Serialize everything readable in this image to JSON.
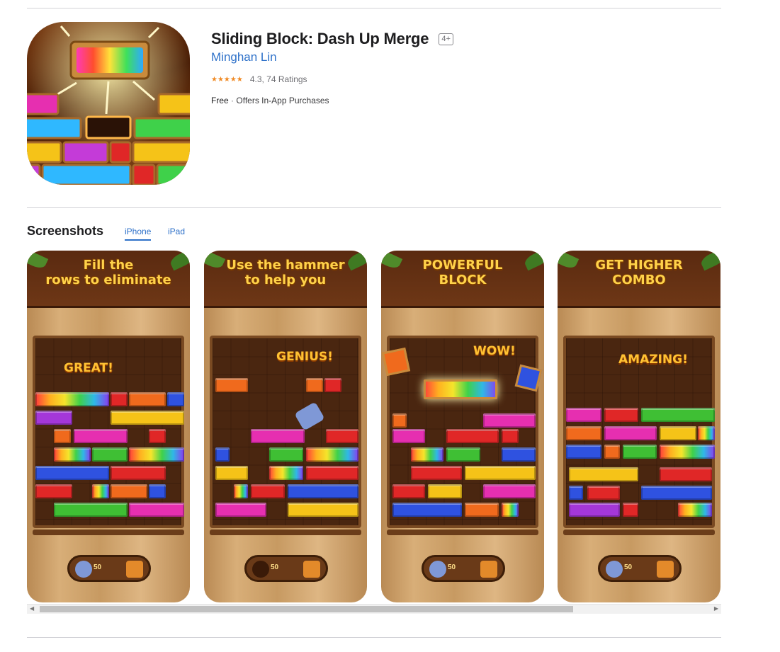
{
  "app": {
    "title": "Sliding Block: Dash Up Merge",
    "age_rating": "4+",
    "developer": "Minghan Lin",
    "stars": "★★★★★",
    "rating_value": 4.3,
    "rating_text": "4.3, 74 Ratings",
    "price": "Free",
    "price_separator": "·",
    "in_app": "Offers In-App Purchases",
    "star_color": "#f08a24",
    "link_color": "#2e71c9"
  },
  "screenshots": {
    "heading": "Screenshots",
    "tabs": [
      {
        "label": "iPhone",
        "selected": true
      },
      {
        "label": "iPad",
        "selected": false
      }
    ],
    "items": [
      {
        "caption": "Fill the\nrows to eliminate",
        "praise": "GREAT!",
        "coin_label": "50",
        "hammer": "hammer-icon",
        "gift": "gift-icon"
      },
      {
        "caption": "Use the hammer\nto help you",
        "praise": "GENIUS!",
        "coin_label": "50",
        "hammer": "empty-slot",
        "gift": "gift-icon"
      },
      {
        "caption": "POWERFUL\nBLOCK",
        "praise": "WOW!",
        "coin_label": "50",
        "hammer": "hammer-icon",
        "gift": "gift-icon"
      },
      {
        "caption": "GET HIGHER\nCOMBO",
        "praise": "AMAZING!",
        "coin_label": "50",
        "hammer": "hammer-icon",
        "gift": "gift-icon"
      }
    ]
  },
  "scrollbar": {
    "left_arrow": "◀",
    "right_arrow": "▶",
    "thumb_fraction": 0.77
  }
}
